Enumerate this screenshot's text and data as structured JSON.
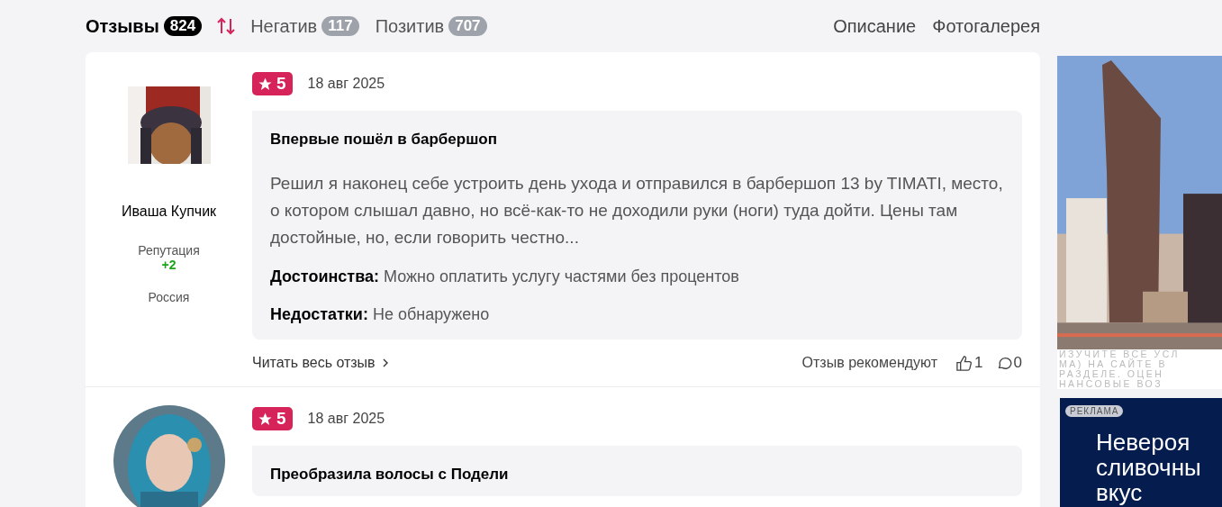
{
  "tabs": [
    {
      "label": "Отзывы",
      "count": "824",
      "selected": true
    },
    {
      "label": "Негатив",
      "count": "117",
      "selected": false
    },
    {
      "label": "Позитив",
      "count": "707",
      "selected": false
    }
  ],
  "links": [
    "Описание",
    "Фотогалерея"
  ],
  "reviews": [
    {
      "author": {
        "name": "Иваша Купчик",
        "avatar": {
          "kind": "square"
        },
        "reputation_label": "Репутация",
        "reputation_value": "+2",
        "country": "Россия"
      },
      "rating": "5",
      "date": "18 авг 2025",
      "title": "Впервые пошёл в барбершоп",
      "text": "Решил я наконец себе устроить день ухода и отправился в барбершоп 13 by TIMATI, место, о котором слышал давно, но всё-как-то не доходили руки (ноги) туда дойти. Цены там достойные, но, если говорить честно...",
      "pros_label": "Достоинства:",
      "pros": "Можно оплатить услугу частями без процентов",
      "cons_label": "Недостатки:",
      "cons": "Не обнаружено",
      "read_more": "Читать весь отзыв",
      "recommend_label": "Отзыв рекомендуют",
      "likes": "1",
      "comments": "0"
    },
    {
      "author": {
        "avatar": {
          "kind": "circle"
        }
      },
      "rating": "5",
      "date": "18 авг 2025",
      "title": "Преобразила волосы с Подели"
    }
  ],
  "ads": [
    {
      "kind": "picture",
      "disclaimer": [
        "ИЗУЧИТЕ ВСЕ УСЛ",
        "МА) НА САЙТЕ В",
        "РАЗДЕЛЕ. ОЦЕН",
        "НАНСОВЫЕ ВОЗ"
      ]
    },
    {
      "kind": "text",
      "badge": "РЕКЛАМА",
      "headline": [
        "Невероя",
        "сливочны",
        "вкус"
      ]
    }
  ]
}
